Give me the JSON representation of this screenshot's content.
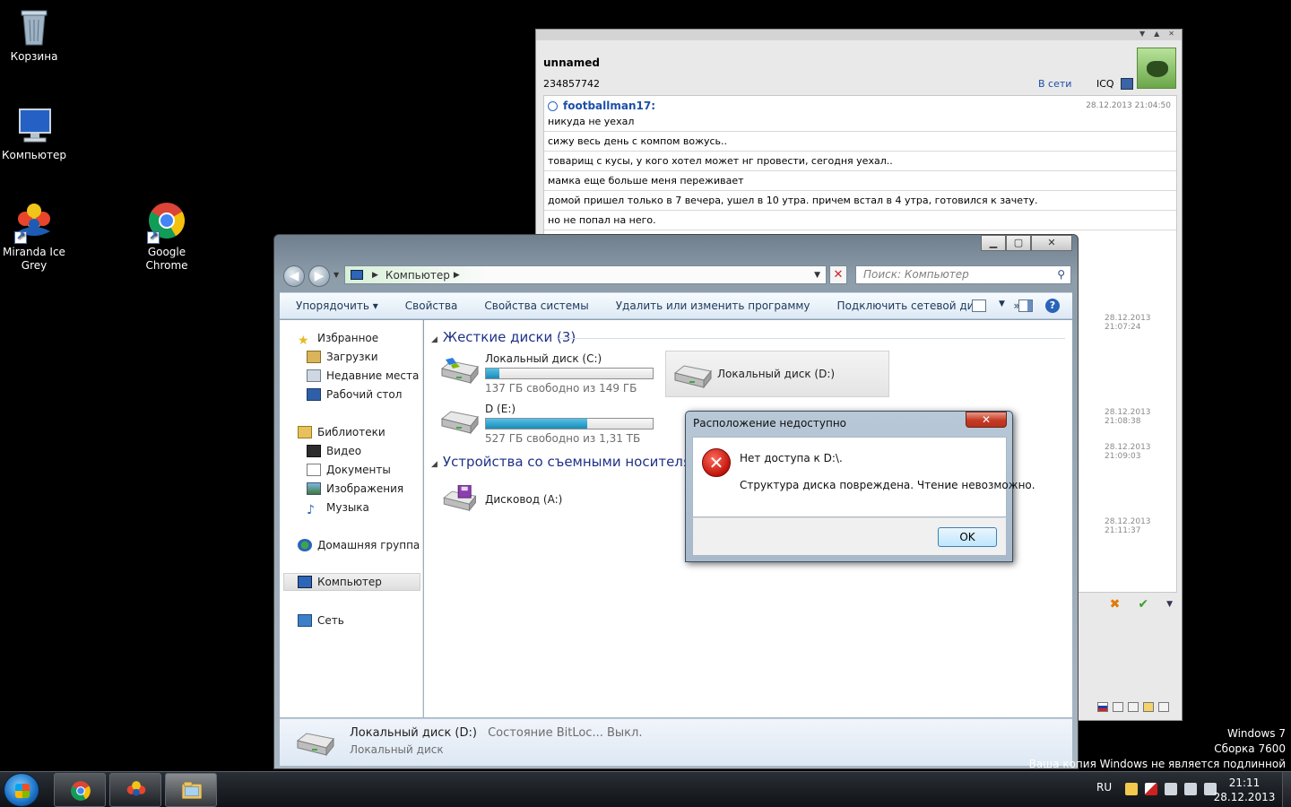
{
  "desktop": {
    "icons": [
      {
        "label": "Корзина"
      },
      {
        "label": "Компьютер"
      },
      {
        "label": "Miranda Ice Grey"
      },
      {
        "label": "Google Chrome"
      }
    ]
  },
  "miranda": {
    "contact_name": "unnamed",
    "uin": "234857742",
    "status": "В сети",
    "protocol": "ICQ",
    "first_message_nick": "footballman17:",
    "first_message_time": "28.12.2013 21:04:50",
    "messages": [
      "никуда не уехал",
      "сижу весь день с компом вожусь..",
      "товарищ с кусы, у кого хотел может нг провести, сегодня уехал..",
      "мамка еще больше меня переживает",
      "домой пришел только в 7 вечера, ушел в 10 утра. причем встал в 4 утра, готовился к зачету.",
      "но не попал на него."
    ],
    "side_timestamps": [
      "28.12.2013 21:07:24",
      "28.12.2013 21:08:38",
      "28.12.2013 21:09:03",
      "28.12.2013 21:11:37"
    ]
  },
  "explorer": {
    "address": "Компьютер",
    "search_placeholder": "Поиск: Компьютер",
    "toolbar": {
      "organize": "Упорядочить",
      "properties": "Свойства",
      "system_properties": "Свойства системы",
      "uninstall": "Удалить или изменить программу",
      "map_drive": "Подключить сетевой диск",
      "more": "»"
    },
    "nav": {
      "favorites": "Избранное",
      "downloads": "Загрузки",
      "recent": "Недавние места",
      "desktop": "Рабочий стол",
      "libraries": "Библиотеки",
      "video": "Видео",
      "documents": "Документы",
      "pictures": "Изображения",
      "music": "Музыка",
      "homegroup": "Домашняя группа",
      "computer": "Компьютер",
      "network": "Сеть"
    },
    "groups": {
      "hard_disks": "Жесткие диски (3)",
      "removable": "Устройства со съемными носителями"
    },
    "drives": {
      "c_name": "Локальный диск (C:)",
      "c_free": "137 ГБ свободно из 149 ГБ",
      "c_used_fraction": 0.08,
      "d_name": "Локальный диск (D:)",
      "e_name": "D (E:)",
      "e_free": "527 ГБ свободно из 1,31 ТБ",
      "e_used_fraction": 0.61,
      "a_name": "Дисковод (A:)"
    },
    "details": {
      "name": "Локальный диск (D:)",
      "bitlocker_label": "Состояние BitLoc...",
      "bitlocker_value": "Выкл.",
      "type": "Локальный диск"
    }
  },
  "dialog": {
    "title": "Расположение недоступно",
    "message1": "Нет доступа к D:\\.",
    "message2": "Структура диска повреждена. Чтение невозможно.",
    "ok": "OK"
  },
  "watermark": {
    "line1": "Windows 7",
    "line2": "Сборка 7600",
    "line3": "Ваша копия Windows не является подлинной"
  },
  "taskbar": {
    "lang": "RU",
    "time": "21:11",
    "date": "28.12.2013"
  },
  "colors": {
    "accent": "#1e3287",
    "link": "#1c4fa8",
    "error": "#c0140a"
  }
}
